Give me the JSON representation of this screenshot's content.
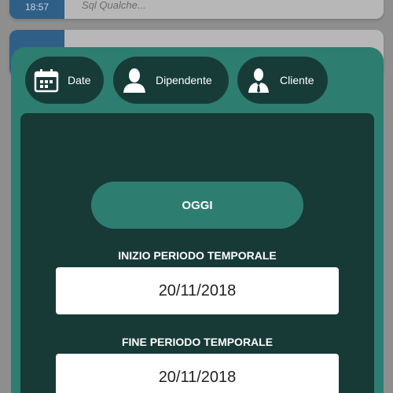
{
  "background_list": {
    "row1_time": "18:57",
    "row1_subtext": "Sql Qualche..."
  },
  "filter_tabs": [
    {
      "label": "Date",
      "icon": "calendar-icon"
    },
    {
      "label": "Dipendente",
      "icon": "person-icon"
    },
    {
      "label": "Cliente",
      "icon": "businessman-icon"
    }
  ],
  "date_filter": {
    "today_label": "OGGI",
    "start_label": "INIZIO PERIODO TEMPORALE",
    "start_value": "20/11/2018",
    "end_label": "FINE PERIODO TEMPORALE",
    "end_value": "20/11/2018"
  },
  "colors": {
    "panel": "#2e7d71",
    "panel_dark": "#173a37",
    "accent_time": "#2f5f86"
  }
}
